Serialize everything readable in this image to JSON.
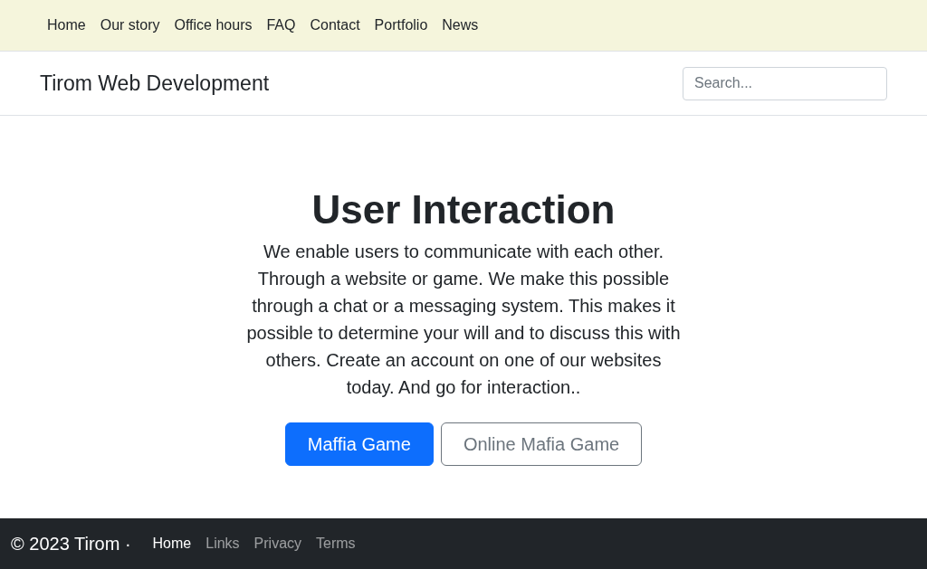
{
  "top_nav": {
    "items": [
      "Home",
      "Our story",
      "Office hours",
      "FAQ",
      "Contact",
      "Portfolio",
      "News"
    ]
  },
  "header": {
    "title": "Tirom Web Development",
    "search": {
      "placeholder": "Search..."
    }
  },
  "hero": {
    "title": "User Interaction",
    "text": "We enable users to communicate with each other. Through a website or game. We make this possible through a chat or a messaging system. This makes it possible to determine your will and to discuss this with others. Create an account on one of our websites today. And go for interaction..",
    "buttons": [
      {
        "label": "Maffia Game",
        "kind": "primary"
      },
      {
        "label": "Online Mafia Game",
        "kind": "outline"
      }
    ]
  },
  "footer": {
    "copyright": "© 2023 Tirom ·",
    "links": [
      {
        "label": "Home",
        "selected": true
      },
      {
        "label": "Links",
        "selected": false
      },
      {
        "label": "Privacy",
        "selected": false
      },
      {
        "label": "Terms",
        "selected": false
      }
    ]
  }
}
